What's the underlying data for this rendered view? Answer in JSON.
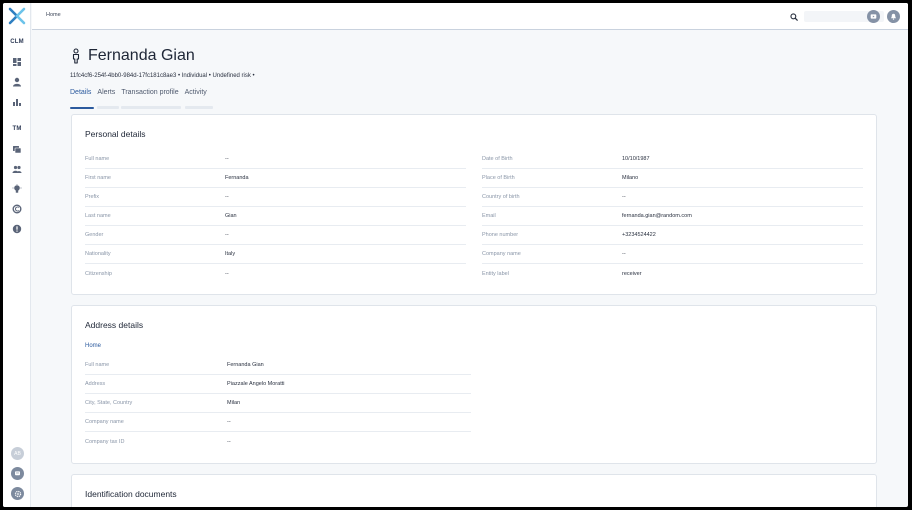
{
  "breadcrumb": "Home",
  "sidebar": {
    "section_clm": "CLM",
    "section_tm": "TM",
    "avatar_initials": "AB",
    "icons_clm": [
      "dashboard-icon",
      "person-icon",
      "bar-chart-icon"
    ],
    "icons_tm": [
      "cards-icon",
      "people-icon",
      "lightbulb-icon",
      "currency-icon",
      "alert-icon"
    ]
  },
  "search": {
    "placeholder": ""
  },
  "profile": {
    "name": "Fernanda Gian",
    "subline": "11fc4cf6-254f-4bb0-984d-17fc181c8ae3 • Individual • Undefined risk •"
  },
  "tabs": [
    {
      "label": "Details",
      "active": true
    },
    {
      "label": "Alerts",
      "active": false
    },
    {
      "label": "Transaction profile",
      "active": false
    },
    {
      "label": "Activity",
      "active": false
    }
  ],
  "personal": {
    "title": "Personal details",
    "left": [
      {
        "label": "Full name",
        "value": "--"
      },
      {
        "label": "First name",
        "value": "Fernanda"
      },
      {
        "label": "Prefix",
        "value": "--"
      },
      {
        "label": "Last name",
        "value": "Gian"
      },
      {
        "label": "Gender",
        "value": "--"
      },
      {
        "label": "Nationality",
        "value": "Italy"
      },
      {
        "label": "Citizenship",
        "value": "--"
      }
    ],
    "right": [
      {
        "label": "Date of Birth",
        "value": "10/10/1987"
      },
      {
        "label": "Place of Birth",
        "value": "Milano"
      },
      {
        "label": "Country of birth",
        "value": "--"
      },
      {
        "label": "Email",
        "value": "fernanda.gian@random.com"
      },
      {
        "label": "Phone number",
        "value": "+3234524422"
      },
      {
        "label": "Company name",
        "value": "--"
      },
      {
        "label": "Entity label",
        "value": "receiver"
      }
    ]
  },
  "address": {
    "title": "Address details",
    "type": "Home",
    "rows": [
      {
        "label": "Full name",
        "value": "Fernanda Gian"
      },
      {
        "label": "Address",
        "value": "Piazzale Angelo Moratti"
      },
      {
        "label": "City, State, Country",
        "value": "Milan"
      },
      {
        "label": "Company name",
        "value": "--"
      },
      {
        "label": "Company tax ID",
        "value": "--"
      }
    ]
  },
  "identification": {
    "title": "Identification documents"
  },
  "colors": {
    "accent": "#2b5a9e",
    "logo_blue": "#2f7fc1",
    "logo_light": "#6cc3ea"
  }
}
